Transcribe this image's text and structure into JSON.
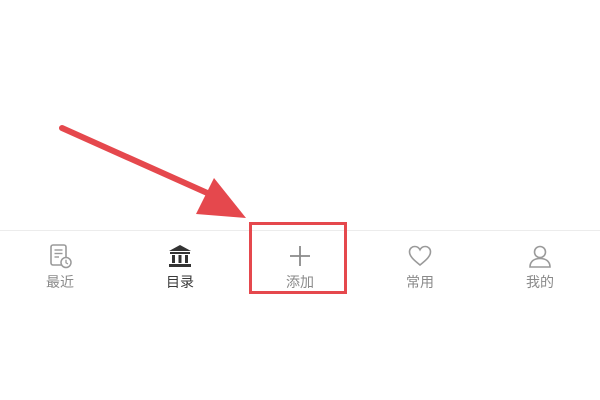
{
  "tab_bar": {
    "items": [
      {
        "label": "最近",
        "icon": "recent-document-icon",
        "active": false
      },
      {
        "label": "目录",
        "icon": "library-icon",
        "active": true
      },
      {
        "label": "添加",
        "icon": "plus-icon",
        "active": false
      },
      {
        "label": "常用",
        "icon": "heart-icon",
        "active": false
      },
      {
        "label": "我的",
        "icon": "user-icon",
        "active": false
      }
    ]
  },
  "colors": {
    "annotation_red": "#e5484d",
    "inactive_gray": "#8a8a8a",
    "active_dark": "#3a3a3a"
  }
}
